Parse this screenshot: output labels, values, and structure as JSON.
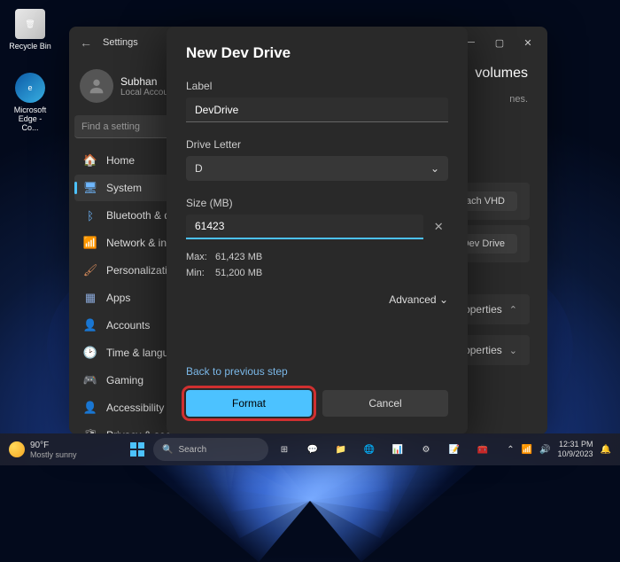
{
  "desktop": {
    "icons": [
      {
        "label": "Recycle Bin"
      },
      {
        "label": "Microsoft Edge - Co..."
      }
    ]
  },
  "settings": {
    "title": "Settings",
    "user": {
      "name": "Subhan",
      "account": "Local Account"
    },
    "search_placeholder": "Find a setting",
    "nav": [
      {
        "icon": "🏠",
        "label": "Home",
        "color": "#e0b050"
      },
      {
        "icon": "🖥",
        "label": "System",
        "color": "#6fb8ff",
        "active": true
      },
      {
        "icon": "ᛒ",
        "label": "Bluetooth & devices",
        "color": "#6fb8ff"
      },
      {
        "icon": "📶",
        "label": "Network & internet",
        "color": "#4fb89a"
      },
      {
        "icon": "🖌",
        "label": "Personalization",
        "color": "#d48a5a"
      },
      {
        "icon": "▦",
        "label": "Apps",
        "color": "#8aa8d8"
      },
      {
        "icon": "👤",
        "label": "Accounts",
        "color": "#d88a8a"
      },
      {
        "icon": "🕑",
        "label": "Time & language",
        "color": "#aaa"
      },
      {
        "icon": "🎮",
        "label": "Gaming",
        "color": "#8ac88a"
      },
      {
        "icon": "👤",
        "label": "Accessibility",
        "color": "#8ab8d8"
      },
      {
        "icon": "🛡",
        "label": "Privacy & security",
        "color": "#aaa"
      }
    ],
    "main": {
      "heading_suffix": "volumes",
      "text_fragment": "nes.",
      "buttons": {
        "attach": "Attach VHD",
        "create": "Create Dev Drive"
      },
      "rows": {
        "properties": "Properties"
      }
    }
  },
  "dialog": {
    "title": "New Dev Drive",
    "label_label": "Label",
    "label_value": "DevDrive",
    "letter_label": "Drive Letter",
    "letter_value": "D",
    "size_label": "Size (MB)",
    "size_value": "61423",
    "max_label": "Max:",
    "max_value": "61,423 MB",
    "min_label": "Min:",
    "min_value": "51,200 MB",
    "advanced": "Advanced",
    "back": "Back to previous step",
    "format": "Format",
    "cancel": "Cancel"
  },
  "taskbar": {
    "weather": {
      "temp": "90°F",
      "desc": "Mostly sunny"
    },
    "search_placeholder": "Search",
    "clock": {
      "time": "12:31 PM",
      "date": "10/9/2023"
    }
  }
}
